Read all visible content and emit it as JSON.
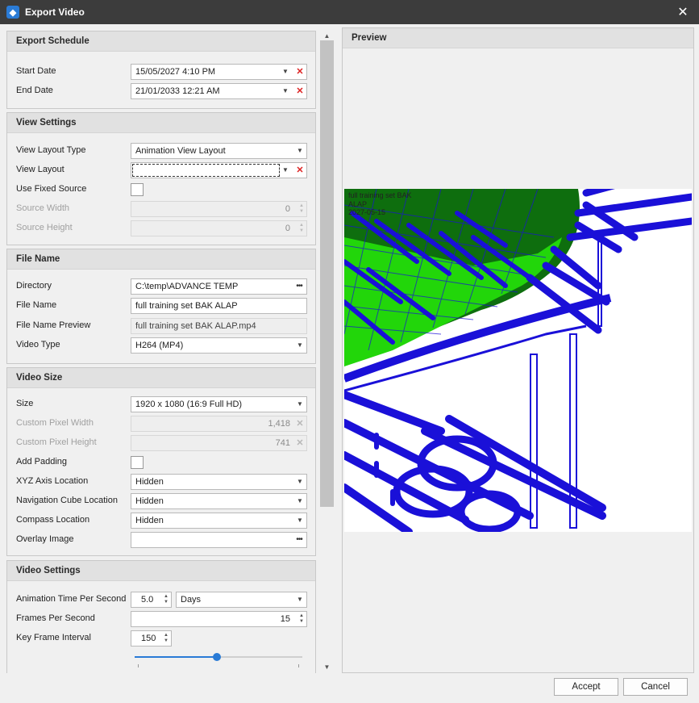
{
  "window": {
    "title": "Export Video",
    "close_glyph": "✕",
    "icon": "app-logo-icon"
  },
  "export_schedule": {
    "header": "Export Schedule",
    "start_date_label": "Start Date",
    "start_date_value": "15/05/2027 4:10 PM",
    "end_date_label": "End Date",
    "end_date_value": "21/01/2033 12:21 AM"
  },
  "view_settings": {
    "header": "View Settings",
    "layout_type_label": "View Layout Type",
    "layout_type_value": "Animation View Layout",
    "layout_label": "View Layout",
    "layout_value": "",
    "fixed_source_label": "Use Fixed Source",
    "fixed_source_checked": false,
    "source_width_label": "Source Width",
    "source_width_value": "0",
    "source_height_label": "Source Height",
    "source_height_value": "0"
  },
  "file_name": {
    "header": "File Name",
    "directory_label": "Directory",
    "directory_value": "C:\\temp\\ADVANCE TEMP",
    "file_name_label": "File Name",
    "file_name_value": "full training set BAK ALAP",
    "preview_label": "File Name Preview",
    "preview_value": "full training set BAK ALAP.mp4",
    "video_type_label": "Video Type",
    "video_type_value": "H264 (MP4)"
  },
  "video_size": {
    "header": "Video Size",
    "size_label": "Size",
    "size_value": "1920 x 1080 (16:9 Full HD)",
    "custom_width_label": "Custom Pixel Width",
    "custom_width_value": "1,418",
    "custom_height_label": "Custom Pixel Height",
    "custom_height_value": "741",
    "padding_label": "Add Padding",
    "padding_checked": false,
    "xyz_label": "XYZ Axis Location",
    "xyz_value": "Hidden",
    "navcube_label": "Navigation Cube Location",
    "navcube_value": "Hidden",
    "compass_label": "Compass Location",
    "compass_value": "Hidden",
    "overlay_label": "Overlay Image",
    "overlay_value": ""
  },
  "video_settings": {
    "header": "Video Settings",
    "anim_time_label": "Animation Time Per Second",
    "anim_time_value": "5.0",
    "anim_unit_value": "Days",
    "fps_label": "Frames Per Second",
    "fps_value": "15",
    "keyframe_label": "Key Frame Interval",
    "keyframe_value": "150",
    "slider_fraction": 0.49
  },
  "preview": {
    "header": "Preview",
    "overlay_line1": "full training set BAK",
    "overlay_line2": "ALAP",
    "overlay_line3": "2027-05-15"
  },
  "buttons": {
    "accept": "Accept",
    "cancel": "Cancel"
  },
  "colors": {
    "accent": "#2a7bd6",
    "model_blue": "#1a10d8",
    "model_green": "#22d60a",
    "dark_green": "#0e6e0e"
  }
}
